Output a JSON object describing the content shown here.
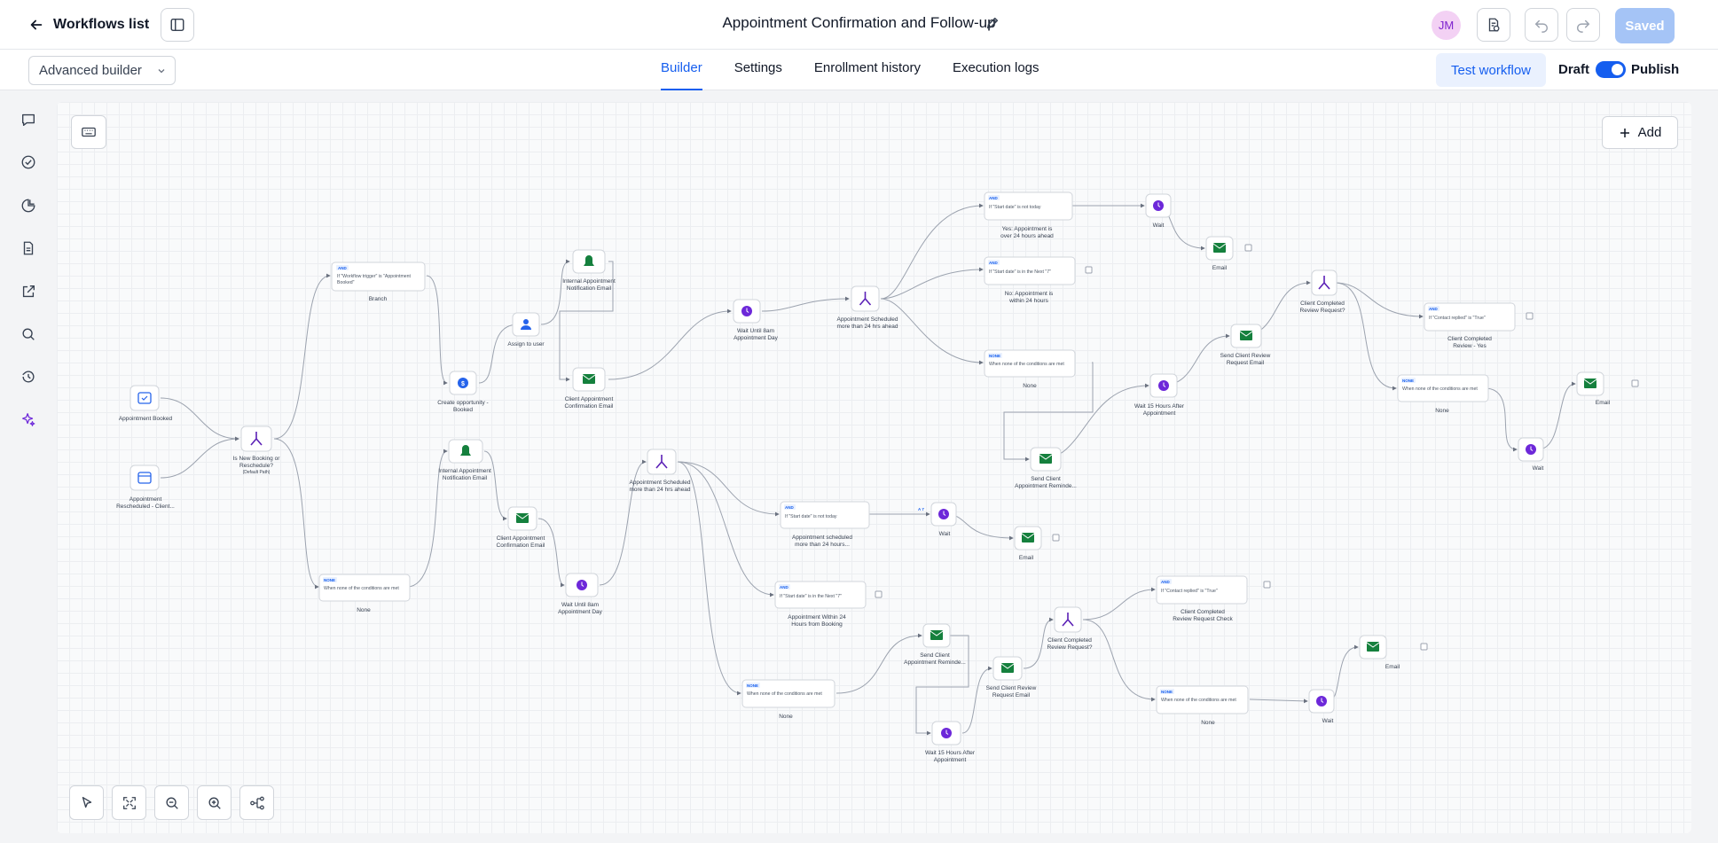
{
  "header": {
    "back_label": "Workflows list",
    "title": "Appointment Confirmation and Follow-up",
    "avatar_initials": "JM",
    "saved_label": "Saved"
  },
  "subbar": {
    "builder_mode": "Advanced builder",
    "tabs": [
      {
        "label": "Builder",
        "active": true
      },
      {
        "label": "Settings",
        "active": false
      },
      {
        "label": "Enrollment history",
        "active": false
      },
      {
        "label": "Execution logs",
        "active": false
      }
    ],
    "test_label": "Test workflow",
    "draft_label": "Draft",
    "publish_label": "Publish",
    "publish_toggle_on": true
  },
  "rail": [
    "message-icon",
    "check-circle-icon",
    "pie-chart-icon",
    "file-icon",
    "external-link-icon",
    "search-icon",
    "history-icon",
    "sparkles-icon"
  ],
  "canvas": {
    "add_label": "Add",
    "tools": [
      "pointer-icon",
      "fit-view-icon",
      "zoom-out-icon",
      "zoom-in-icon",
      "auto-layout-icon"
    ]
  },
  "colors": {
    "accent": "#155eef",
    "wait": "#6d28d9",
    "email": "#15803d",
    "branch": "#5b21b6",
    "trigger": "#2563eb"
  },
  "nodes": {
    "trigger1": "Appointment Booked",
    "trigger2": [
      "Appointment",
      "Rescheduled - Client..."
    ],
    "branch1": [
      "Is New Booking or",
      "Reschedule?"
    ],
    "branch1_sub": "(Default Path)",
    "cond_booked_badge": "AND",
    "cond_booked_text": [
      "If \"Workflow trigger\" is \"Appointment",
      "Booked\""
    ],
    "cond_booked_label": "Branch",
    "create_opp": [
      "Create opportunity -",
      "Booked"
    ],
    "assign_user": "Assign to user",
    "internal_notif_1": [
      "Internal Appointment",
      "Notification Email"
    ],
    "client_conf_1": [
      "Client Appointment",
      "Confirmation Email"
    ],
    "wait_until_1": [
      "Wait Until 8am",
      "Appointment Day"
    ],
    "appt_sched_1": [
      "Appointment Scheduled",
      "more than 24 hrs ahead"
    ],
    "cond_yes_badge": "AND",
    "cond_yes_text": "If \"Start date\" is not today",
    "cond_yes_label": [
      "Yes: Appointment is",
      "over 24 hours ahead"
    ],
    "cond_no_badge": "AND",
    "cond_no_text": "If \"Start date\" is in the Next \"7\"",
    "cond_no_label": [
      "No: Appointment is",
      "within 24 hours"
    ],
    "cond_none_badge": "NONE",
    "cond_none_text": "When none of the conditions are met",
    "none_label": "None",
    "wait_label": "Wait",
    "email_label": "Email",
    "send_reminder": [
      "Send Client",
      "Appointment Reminde..."
    ],
    "wait_15": [
      "Wait 15 Hours After",
      "Appointment"
    ],
    "send_review": [
      "Send Client Review",
      "Request Email"
    ],
    "review_check": [
      "Client Completed",
      "Review Request?"
    ],
    "cond_replied_badge": "AND",
    "cond_replied_text": "If \"Contact replied\" is \"True\"",
    "review_yes": [
      "Client Completed",
      "Review - Yes"
    ],
    "internal_notif_2": [
      "Internal Appointment",
      "Notification Email"
    ],
    "client_conf_2": [
      "Client Appointment",
      "Confirmation Email"
    ],
    "wait_until_2": [
      "Wait Until 8am",
      "Appointment Day"
    ],
    "appt_sched_2": [
      "Appointment Scheduled",
      "more than 24 hrs ahead"
    ],
    "cond_sched_label": [
      "Appointment scheduled",
      "more than 24 hours..."
    ],
    "cond_within_label": [
      "Appointment Within 24",
      "Hours from Booking"
    ],
    "wait_tag": "A 7",
    "review_check_label": [
      "Client Completed",
      "Review Request Check"
    ]
  }
}
